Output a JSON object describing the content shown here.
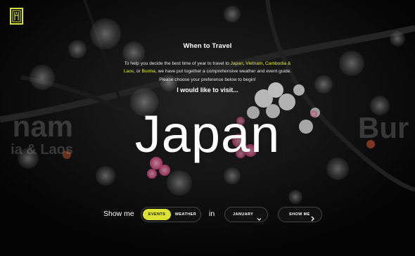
{
  "brand": {
    "logo_icon": "lantern-logo-icon",
    "accent": "#e3ec3a"
  },
  "intro": {
    "title": "When to Travel",
    "text_1": "To help you decide the best time of year to travel to ",
    "link_japan": "Japan",
    "sep_1": ", ",
    "link_vietnam": "Vietnam",
    "sep_2": ", ",
    "link_cambodia": "Cambodia & Laos",
    "sep_3": ", or ",
    "link_burma": "Burma",
    "text_2": ", we have put together a comprehensive weather and event guide. Please choose your preference below to begin!"
  },
  "visit_label": "I would like to visit...",
  "carousel": {
    "current": "Japan",
    "prev_name": "nam",
    "prev_sub": "ia & Laos",
    "next_name": "Bur"
  },
  "controls": {
    "show_me_label": "Show me",
    "toggle_options": [
      "EVENTS",
      "WEATHER"
    ],
    "toggle_selected": "EVENTS",
    "in_label": "in",
    "month_selected": "JANUARY",
    "go_label": "SHOW ME"
  }
}
